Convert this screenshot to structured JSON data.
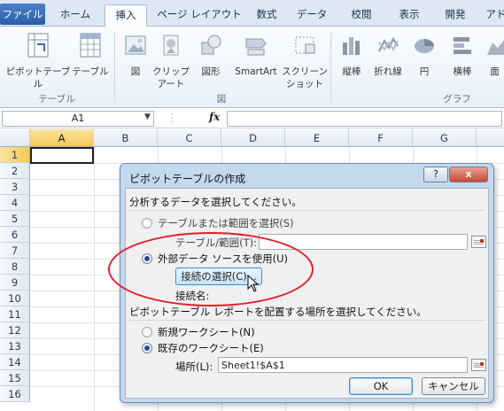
{
  "ribbon_tabs": [
    "ファイル",
    "ホーム",
    "挿入",
    "ページ レイアウト",
    "数式",
    "データ",
    "校閲",
    "表示",
    "開発",
    "アド"
  ],
  "ribbon": {
    "groups": [
      "テーブル",
      "図",
      "グラフ"
    ],
    "buttons": {
      "pivot": "ピボットテーブル",
      "table": "テーブル",
      "picture": "図",
      "clipart_1": "クリップ",
      "clipart_2": "アート",
      "shapes": "図形",
      "smartart": "SmartArt",
      "screenshot_1": "スクリーン",
      "screenshot_2": "ショット",
      "column": "縦棒",
      "line": "折れ線",
      "pie": "円",
      "bar": "横棒",
      "area": "面"
    }
  },
  "formula_bar": {
    "name_box": "A1",
    "fx": "fx",
    "formula": ""
  },
  "sheet": {
    "columns": [
      "A",
      "B",
      "C",
      "D",
      "E",
      "F",
      "G"
    ],
    "rows": [
      "1",
      "2",
      "3",
      "4",
      "5",
      "6",
      "7",
      "8",
      "9",
      "10",
      "11",
      "12",
      "13",
      "14",
      "15",
      "16"
    ],
    "selected_cell": "A1"
  },
  "dialog": {
    "title": "ピボットテーブルの作成",
    "help": "?",
    "close": "x",
    "section1": "分析するデータを選択してください。",
    "opt_range": "テーブルまたは範囲を選択(S)",
    "range_label": "テーブル/範囲(T):",
    "range_value": "",
    "opt_external": "外部データ ソースを使用(U)",
    "connection_button": "接続の選択(C)...",
    "connection_name_label": "接続名:",
    "section2": "ピボットテーブル レポートを配置する場所を選択してください。",
    "opt_new_sheet": "新規ワークシート(N)",
    "opt_existing_sheet": "既存のワークシート(E)",
    "location_label": "場所(L):",
    "location_value": "Sheet1!$A$1",
    "ok": "OK",
    "cancel": "キャンセル"
  },
  "annotation_color": "#e0202a"
}
